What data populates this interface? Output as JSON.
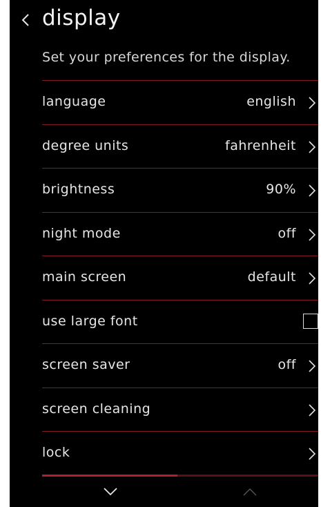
{
  "header": {
    "title": "display",
    "back_icon": "chevron-left-icon"
  },
  "subtitle": "Set your preferences for the display.",
  "settings": [
    {
      "label": "language",
      "value": "english",
      "control": "chevron"
    },
    {
      "label": "degree units",
      "value": "fahrenheit",
      "control": "chevron"
    },
    {
      "label": "brightness",
      "value": "90%",
      "control": "chevron"
    },
    {
      "label": "night mode",
      "value": "off",
      "control": "chevron"
    },
    {
      "label": "main screen",
      "value": "default",
      "control": "chevron"
    },
    {
      "label": "use large font",
      "value": "",
      "control": "checkbox",
      "checked": false
    },
    {
      "label": "screen saver",
      "value": "off",
      "control": "chevron"
    },
    {
      "label": "screen cleaning",
      "value": "",
      "control": "chevron"
    },
    {
      "label": "lock",
      "value": "",
      "control": "chevron"
    }
  ],
  "footer": {
    "scroll_down_icon": "chevron-down-icon",
    "scroll_up_icon": "chevron-up-icon"
  },
  "colors": {
    "background": "#000000",
    "divider": "#8a1a22",
    "accent": "#b3202b",
    "text": "#e6e6e6"
  }
}
